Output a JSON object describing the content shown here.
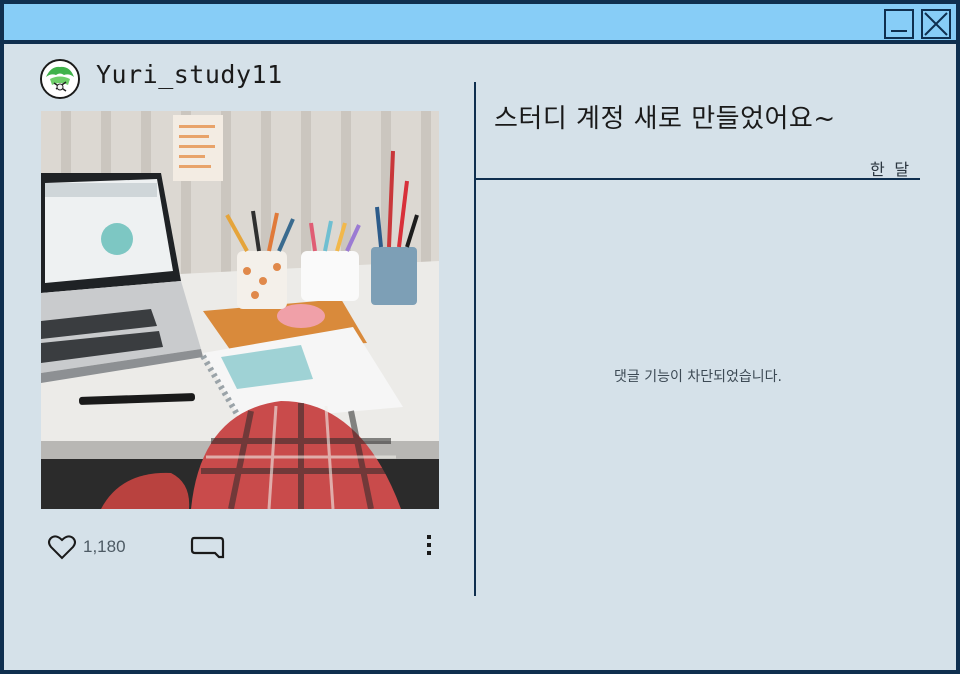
{
  "window": {
    "accent": "#87cdf7",
    "border": "#0f2f4f",
    "background": "#d5e1e9"
  },
  "titlebar": {
    "minimize_icon": "minimize-icon",
    "close_icon": "close-icon"
  },
  "post": {
    "username": "Yuri_study11",
    "avatar_icon": "avatar-icon",
    "image_description_icon": "desk-photo",
    "likes": "1,180",
    "caption": "스터디 계정 새로 만들었어요~",
    "timestamp": "한 달",
    "comments_disabled": "댓글 기능이 차단되었습니다."
  }
}
